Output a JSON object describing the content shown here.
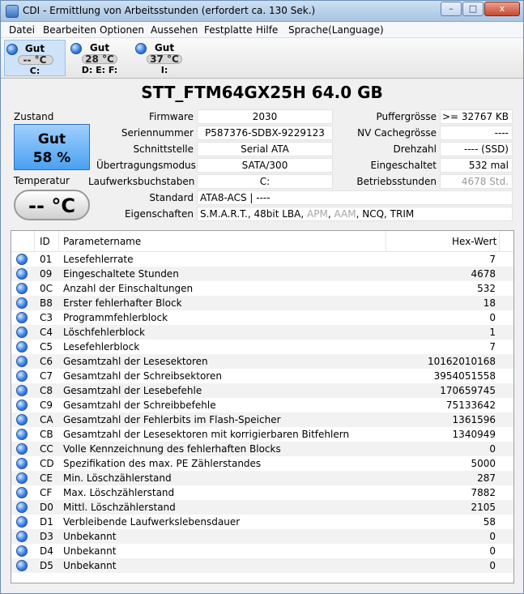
{
  "window": {
    "title": "CDI - Ermittlung von Arbeitsstunden (erfordert ca. 130 Sek.)",
    "min_label": "–",
    "max_label": "□",
    "close_label": "x"
  },
  "menu": [
    "Datei",
    "Bearbeiten",
    "Optionen",
    "Aussehen",
    "Festplatte",
    "Hilfe",
    "Sprache(Language)"
  ],
  "drives": [
    {
      "status": "Gut",
      "temp": "-- °C",
      "letters": "C:",
      "selected": true
    },
    {
      "status": "Gut",
      "temp": "28 °C",
      "letters": "D: E: F:",
      "selected": false
    },
    {
      "status": "Gut",
      "temp": "37 °C",
      "letters": "I:",
      "selected": false
    }
  ],
  "model": "STT_FTM64GX25H  64.0 GB",
  "health": {
    "label": "Zustand",
    "status": "Gut",
    "percent": "58 %",
    "color": "#4aa0f0"
  },
  "temperature": {
    "label": "Temperatur",
    "value": "-- °C"
  },
  "info": {
    "firmware_label": "Firmware",
    "firmware": "2030",
    "serial_label": "Seriennummer",
    "serial": "P587376-SDBX-9229123",
    "interface_label": "Schnittstelle",
    "interface": "Serial ATA",
    "transfer_label": "Übertragungsmodus",
    "transfer": "SATA/300",
    "drive_letters_label": "Laufwerksbuchstaben",
    "drive_letters": "C:",
    "standard_label": "Standard",
    "standard": "ATA8-ACS | ----",
    "features_label": "Eigenschaften",
    "buffer_label": "Puffergrösse",
    "buffer": ">= 32767 KB",
    "nvcache_label": "NV Cachegrösse",
    "nvcache": "----",
    "rpm_label": "Drehzahl",
    "rpm": "---- (SSD)",
    "poweron_count_label": "Eingeschaltet",
    "poweron_count": "532 mal",
    "poweron_hours_label": "Betriebsstunden",
    "poweron_hours": "4678 Std."
  },
  "features": [
    {
      "text": "S.M.A.R.T.",
      "active": true
    },
    {
      "text": "48bit LBA",
      "active": true
    },
    {
      "text": "APM",
      "active": false
    },
    {
      "text": "AAM",
      "active": false
    },
    {
      "text": "NCQ",
      "active": true
    },
    {
      "text": "TRIM",
      "active": true
    }
  ],
  "table": {
    "headers": {
      "id": "ID",
      "name": "Parametername",
      "raw": "Hex-Wert"
    },
    "rows": [
      {
        "id": "01",
        "name": "Lesefehlerrate",
        "raw": "7"
      },
      {
        "id": "09",
        "name": "Eingeschaltete Stunden",
        "raw": "4678"
      },
      {
        "id": "0C",
        "name": "Anzahl der Einschaltungen",
        "raw": "532"
      },
      {
        "id": "B8",
        "name": "Erster fehlerhafter Block",
        "raw": "18"
      },
      {
        "id": "C3",
        "name": "Programmfehlerblock",
        "raw": "0"
      },
      {
        "id": "C4",
        "name": "Löschfehlerblock",
        "raw": "1"
      },
      {
        "id": "C5",
        "name": "Lesefehlerblock",
        "raw": "7"
      },
      {
        "id": "C6",
        "name": "Gesamtzahl der Lesesektoren",
        "raw": "10162010168"
      },
      {
        "id": "C7",
        "name": "Gesamtzahl der Schreibsektoren",
        "raw": "3954051558"
      },
      {
        "id": "C8",
        "name": "Gesamtzahl der Lesebefehle",
        "raw": "170659745"
      },
      {
        "id": "C9",
        "name": "Gesamtzahl der Schreibbefehle",
        "raw": "75133642"
      },
      {
        "id": "CA",
        "name": "Gesamtzahl der Fehlerbits im Flash-Speicher",
        "raw": "1361596"
      },
      {
        "id": "CB",
        "name": "Gesamtzahl der Lesesektoren mit korrigierbaren Bitfehlern",
        "raw": "1340949"
      },
      {
        "id": "CC",
        "name": "Volle Kennzeichnung des fehlerhaften Blocks",
        "raw": "0"
      },
      {
        "id": "CD",
        "name": "Spezifikation des max. PE Zählerstandes",
        "raw": "5000"
      },
      {
        "id": "CE",
        "name": "Min. Löschzählerstand",
        "raw": "287"
      },
      {
        "id": "CF",
        "name": "Max. Löschzählerstand",
        "raw": "7882"
      },
      {
        "id": "D0",
        "name": "Mittl. Löschzählerstand",
        "raw": "2105"
      },
      {
        "id": "D1",
        "name": "Verbleibende Laufwerkslebensdauer",
        "raw": "58"
      },
      {
        "id": "D3",
        "name": "Unbekannt",
        "raw": "0"
      },
      {
        "id": "D4",
        "name": "Unbekannt",
        "raw": "0"
      },
      {
        "id": "D5",
        "name": "Unbekannt",
        "raw": "0"
      }
    ]
  }
}
